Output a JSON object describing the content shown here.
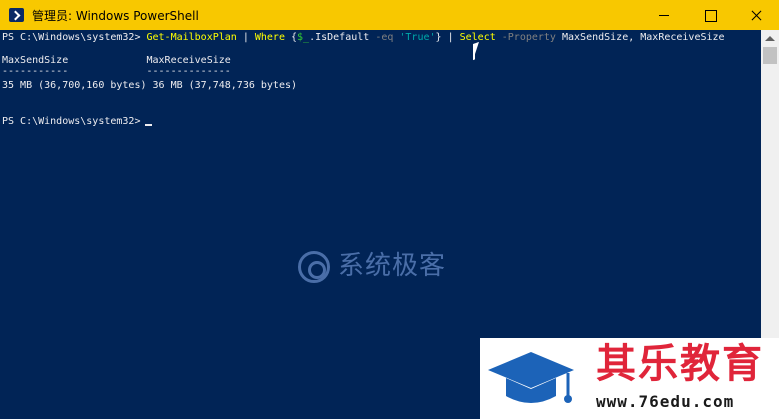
{
  "window": {
    "title": "管理员: Windows PowerShell",
    "icon": "powershell-icon",
    "controls": [
      "minimize-icon",
      "maximize-icon",
      "close-icon"
    ]
  },
  "console": {
    "command_line": {
      "prompt": "PS C:\\Windows\\system32> ",
      "cmd1": "Get-MailboxPlan",
      "pipe1": " | ",
      "cmd2": "Where",
      "brace_open": " {",
      "var": "$_",
      "prop": ".IsDefault ",
      "op": "-eq",
      "str": " 'True'",
      "brace_close": "}",
      "pipe2": " | ",
      "cmd3": "Select",
      "param": " -Property",
      "args": " MaxSendSize, MaxReceiveSize"
    },
    "table": {
      "headers": "MaxSendSize             MaxReceiveSize",
      "underline": "-----------             --------------",
      "row": "35 MB (36,700,160 bytes) 36 MB (37,748,736 bytes)"
    },
    "prompt2": "PS C:\\Windows\\system32> ",
    "colors": {
      "background": "#012456",
      "text": "#eeedf0",
      "cmdlet": "#ffff00",
      "parameter": "#808080",
      "string": "#00aaaa",
      "variable": "#32cd32"
    }
  },
  "watermarks": {
    "center": "系统极客",
    "corner_title": "其乐教育",
    "corner_url": "www.76edu.com"
  },
  "titlebar_color": "#f8c800"
}
